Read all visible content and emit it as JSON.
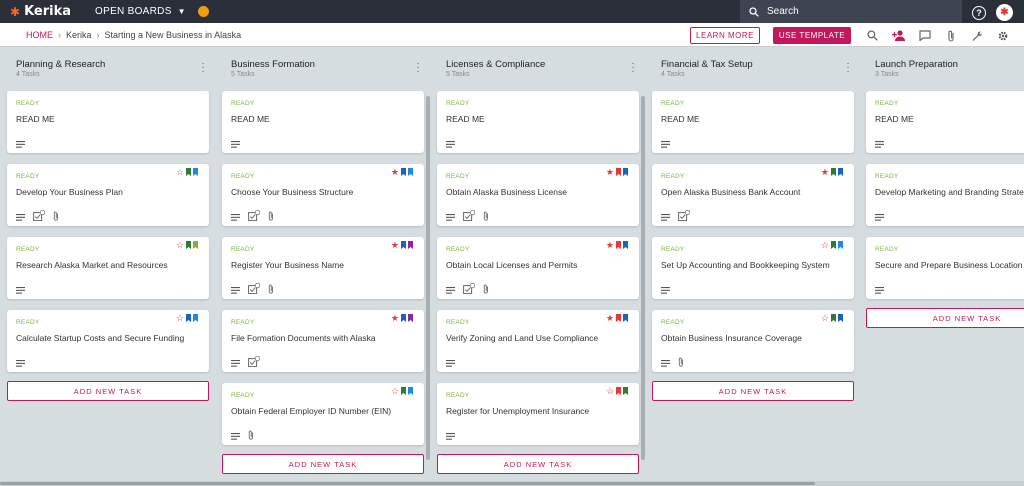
{
  "topbar": {
    "brand": "Kerika",
    "open_boards": "OPEN BOARDS",
    "search_placeholder": "Search",
    "help": "?"
  },
  "breadcrumb": {
    "home": "HOME",
    "org": "Kerika",
    "board": "Starting a New Business in Alaska"
  },
  "actions": {
    "learn_more": "LEARN MORE",
    "use_template": "USE TEMPLATE"
  },
  "colors": {
    "accent": "#c2185b",
    "ready": "#7cb342",
    "topbar": "#2b2f3a"
  },
  "columns": [
    {
      "title": "Planning & Research",
      "count": "4 Tasks",
      "add": "ADD NEW TASK",
      "cards": [
        {
          "status": "READY",
          "title": "READ ME",
          "flags": []
        },
        {
          "status": "READY",
          "title": "Develop Your Business Plan",
          "flags": [
            "#2e7d32",
            "#1e88e5"
          ]
        },
        {
          "status": "READY",
          "title": "Research Alaska Market and Resources",
          "flags": [
            "#2e7d32",
            "#7cb342"
          ]
        },
        {
          "status": "READY",
          "title": "Calculate Startup Costs and Secure Funding",
          "flags": [
            "#1565c0",
            "#1e88e5"
          ]
        }
      ]
    },
    {
      "title": "Business Formation",
      "count": "5 Tasks",
      "add": "ADD NEW TASK",
      "cards": [
        {
          "status": "READY",
          "title": "READ ME",
          "flags": []
        },
        {
          "status": "READY",
          "title": "Choose Your Business Structure",
          "flags": [
            "#1565c0",
            "#1e88e5"
          ]
        },
        {
          "status": "READY",
          "title": "Register Your Business Name",
          "flags": [
            "#1565c0",
            "#8e24aa"
          ]
        },
        {
          "status": "READY",
          "title": "File Formation Documents with Alaska",
          "flags": [
            "#1565c0",
            "#8e24aa"
          ]
        },
        {
          "status": "READY",
          "title": "Obtain Federal Employer ID Number (EIN)",
          "flags": [
            "#2e7d32",
            "#1e88e5"
          ]
        }
      ]
    },
    {
      "title": "Licenses & Compliance",
      "count": "5 Tasks",
      "add": "ADD NEW TASK",
      "cards": [
        {
          "status": "READY",
          "title": "READ ME",
          "flags": []
        },
        {
          "status": "READY",
          "title": "Obtain Alaska Business License",
          "flags": [
            "#e53935",
            "#1565c0"
          ]
        },
        {
          "status": "READY",
          "title": "Obtain Local Licenses and Permits",
          "flags": [
            "#e53935",
            "#1565c0"
          ]
        },
        {
          "status": "READY",
          "title": "Verify Zoning and Land Use Compliance",
          "flags": [
            "#e53935",
            "#1565c0"
          ]
        },
        {
          "status": "READY",
          "title": "Register for Unemployment Insurance",
          "flags": [
            "#e53935",
            "#2e7d32"
          ]
        }
      ]
    },
    {
      "title": "Financial & Tax Setup",
      "count": "4 Tasks",
      "add": "ADD NEW TASK",
      "cards": [
        {
          "status": "READY",
          "title": "READ ME",
          "flags": []
        },
        {
          "status": "READY",
          "title": "Open Alaska Business Bank Account",
          "flags": [
            "#2e7d32",
            "#1565c0"
          ]
        },
        {
          "status": "READY",
          "title": "Set Up Accounting and Bookkeeping System",
          "flags": [
            "#2e7d32",
            "#1e88e5"
          ]
        },
        {
          "status": "READY",
          "title": "Obtain Business Insurance Coverage",
          "flags": [
            "#2e7d32",
            "#1565c0"
          ]
        }
      ]
    },
    {
      "title": "Launch Preparation",
      "count": "3 Tasks",
      "add": "ADD NEW TASK",
      "cards": [
        {
          "status": "READY",
          "title": "READ ME",
          "flags": []
        },
        {
          "status": "READY",
          "title": "Develop Marketing and Branding Strategy",
          "flags": []
        },
        {
          "status": "READY",
          "title": "Secure and Prepare Business Location",
          "flags": [
            "#2e7d32",
            "#1565c0"
          ]
        }
      ]
    }
  ]
}
